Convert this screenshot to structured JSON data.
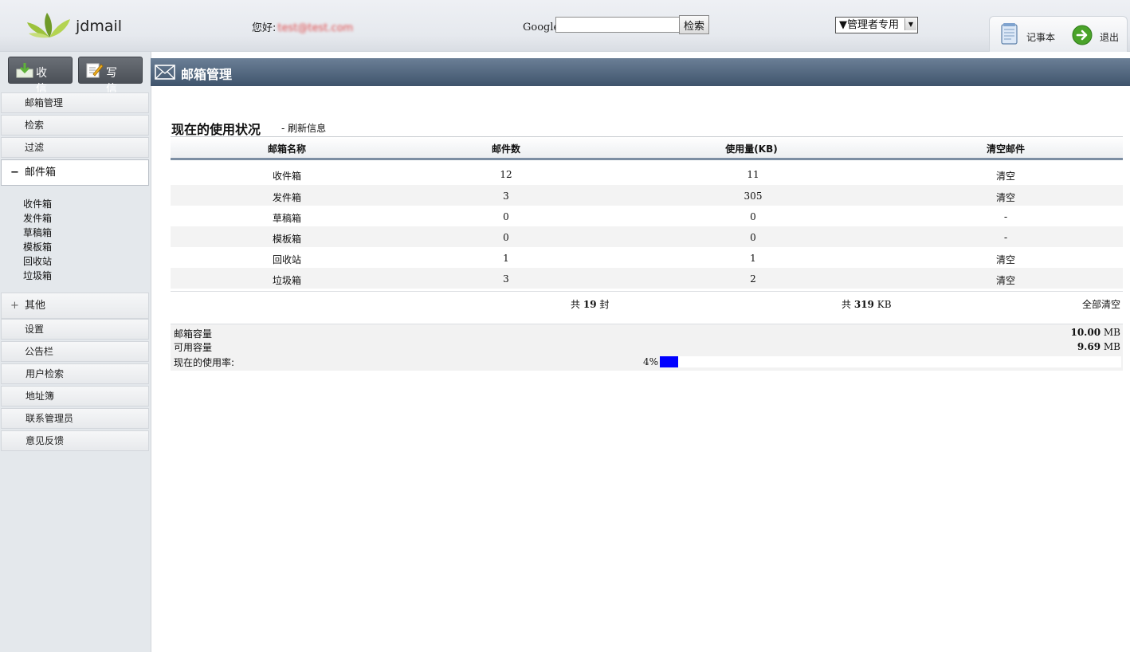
{
  "header": {
    "logo_text": "jdmail",
    "greeting_label": "您好:",
    "greeting_email": "test@test.com",
    "google_label": "Google",
    "search_value": "",
    "search_button": "检索",
    "admin_select_value": "▼管理者专用",
    "memo_label": "记事本",
    "logout_label": "退出"
  },
  "sidebar": {
    "inbox_button": "收 信",
    "compose_button": "写 信",
    "nav": [
      "邮箱管理",
      "检索",
      "过滤"
    ],
    "mailbox_sign": "−",
    "mailbox_label": "邮件箱",
    "folders": [
      "收件箱",
      "发件箱",
      "草稿箱",
      "模板箱",
      "回收站",
      "垃圾箱"
    ],
    "other_sign": "+",
    "other_label": "其他",
    "other_items": [
      "设置",
      "公告栏",
      "用户检索",
      "地址簿",
      "联系管理员",
      "意见反馈"
    ]
  },
  "main": {
    "title": "邮箱管理",
    "section_title": "现在的使用状况",
    "refresh_link": "- 刷新信息",
    "columns": [
      "邮箱名称",
      "邮件数",
      "使用量(KB)",
      "清空邮件"
    ],
    "rows": [
      {
        "name": "收件箱",
        "count": "12",
        "usage": "11",
        "action": "清空"
      },
      {
        "name": "发件箱",
        "count": "3",
        "usage": "305",
        "action": "清空"
      },
      {
        "name": "草稿箱",
        "count": "0",
        "usage": "0",
        "action": "-"
      },
      {
        "name": "模板箱",
        "count": "0",
        "usage": "0",
        "action": "-"
      },
      {
        "name": "回收站",
        "count": "1",
        "usage": "1",
        "action": "清空"
      },
      {
        "name": "垃圾箱",
        "count": "3",
        "usage": "2",
        "action": "清空"
      }
    ],
    "total_prefix": "共",
    "total_count": "19",
    "total_count_unit": "封",
    "total_size": "319",
    "total_size_unit": "KB",
    "clear_all": "全部清空",
    "capacity_label": "邮箱容量",
    "capacity_value": "10.00",
    "available_label": "可用容量",
    "available_value": "9.69",
    "size_unit": "MB",
    "usage_label": "现在的使用率:",
    "usage_percent": "4%",
    "usage_fraction": 0.04
  },
  "colors": {
    "title_bar": "#4f647c",
    "usage_bar": "#0000ff"
  }
}
